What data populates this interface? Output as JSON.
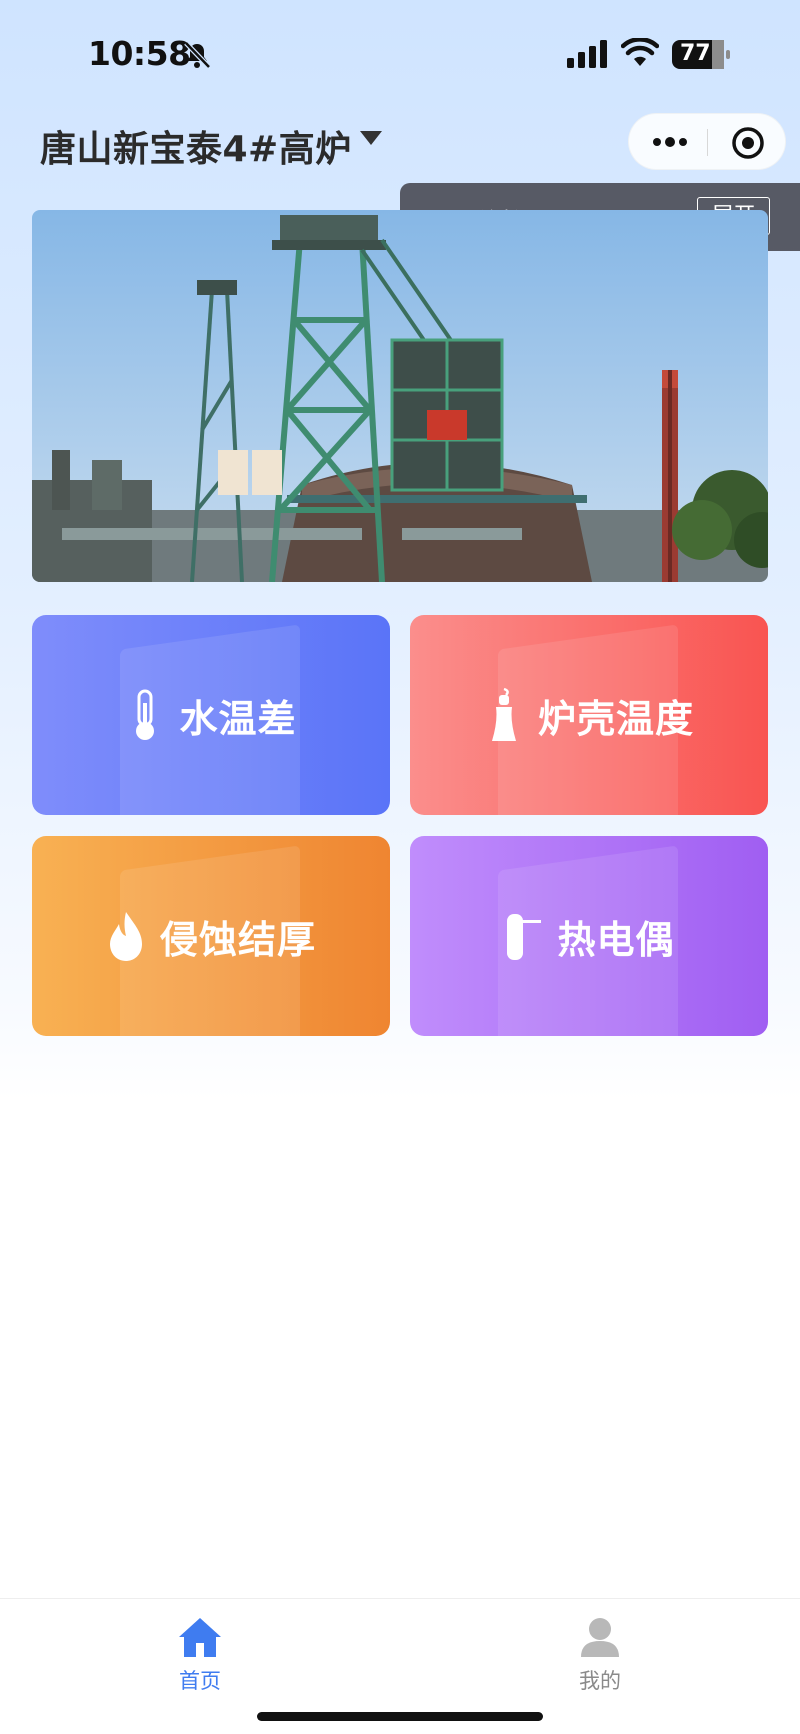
{
  "status_bar": {
    "time": "10:58",
    "battery": "77",
    "icons": [
      "bell-mute-icon",
      "signal-icon",
      "wifi-icon",
      "battery-icon"
    ]
  },
  "header": {
    "title": "唐山新宝泰4#高炉",
    "icons": [
      "caret-down-icon",
      "more-icon",
      "target-icon"
    ]
  },
  "toast": {
    "status": "已连接",
    "button": "展开",
    "status_color": "#27e035"
  },
  "menu": [
    {
      "label": "水温差",
      "icon": "thermometer-icon",
      "color": "#6a80fa"
    },
    {
      "label": "炉壳温度",
      "icon": "furnace-icon",
      "color": "#fa6f6d"
    },
    {
      "label": "侵蚀结厚",
      "icon": "flame-icon",
      "color": "#f39a42"
    },
    {
      "label": "热电偶",
      "icon": "thermocouple-icon",
      "color": "#b176f7"
    }
  ],
  "tabbar": {
    "items": [
      {
        "label": "首页",
        "icon": "home-icon",
        "active": true
      },
      {
        "label": "我的",
        "icon": "user-icon",
        "active": false
      }
    ],
    "active_color": "#3f7cf0"
  }
}
